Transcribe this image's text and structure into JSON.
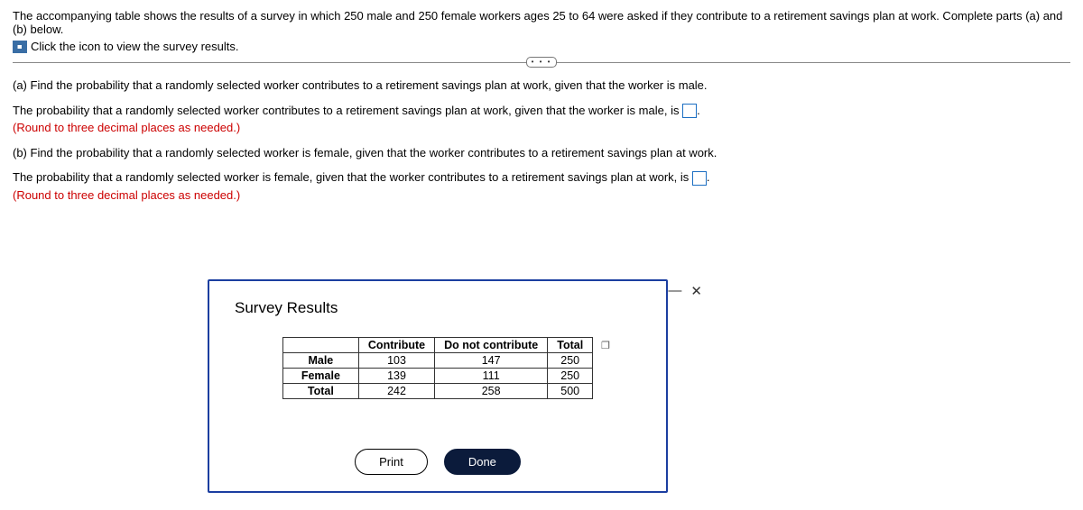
{
  "intro": "The accompanying table shows the results of a survey in which 250 male and 250 female workers ages 25 to 64 were asked if they contribute to a retirement savings plan at work. Complete parts (a) and (b) below.",
  "icon_line": "Click the icon to view the survey results.",
  "ellipsis": "• • •",
  "part_a": {
    "q": "(a) Find the probability that a randomly selected worker contributes to a retirement savings plan at work, given that the worker is male.",
    "stem_before": "The probability that a randomly selected worker contributes to a retirement savings plan at work, given that the worker is male, is ",
    "stem_after": ".",
    "hint": "(Round to three decimal places as needed.)"
  },
  "part_b": {
    "q": "(b) Find the probability that a randomly selected worker is female, given that the worker contributes to a retirement savings plan at work.",
    "stem_before": "The probability that a randomly selected worker is female, given that the worker contributes to a retirement savings plan at work, is ",
    "stem_after": ".",
    "hint": "(Round to three decimal places as needed.)"
  },
  "modal": {
    "title": "Survey Results",
    "headers": {
      "c1": "Contribute",
      "c2": "Do not contribute",
      "c3": "Total"
    },
    "rows": {
      "male": {
        "label": "Male",
        "c1": "103",
        "c2": "147",
        "c3": "250"
      },
      "female": {
        "label": "Female",
        "c1": "139",
        "c2": "111",
        "c3": "250"
      },
      "total": {
        "label": "Total",
        "c1": "242",
        "c2": "258",
        "c3": "500"
      }
    },
    "buttons": {
      "print": "Print",
      "done": "Done"
    },
    "ctrls": {
      "min": "—",
      "close": "✕"
    }
  },
  "chart_data": {
    "type": "table",
    "title": "Survey Results",
    "columns": [
      "",
      "Contribute",
      "Do not contribute",
      "Total"
    ],
    "rows": [
      [
        "Male",
        103,
        147,
        250
      ],
      [
        "Female",
        139,
        111,
        250
      ],
      [
        "Total",
        242,
        258,
        500
      ]
    ]
  }
}
